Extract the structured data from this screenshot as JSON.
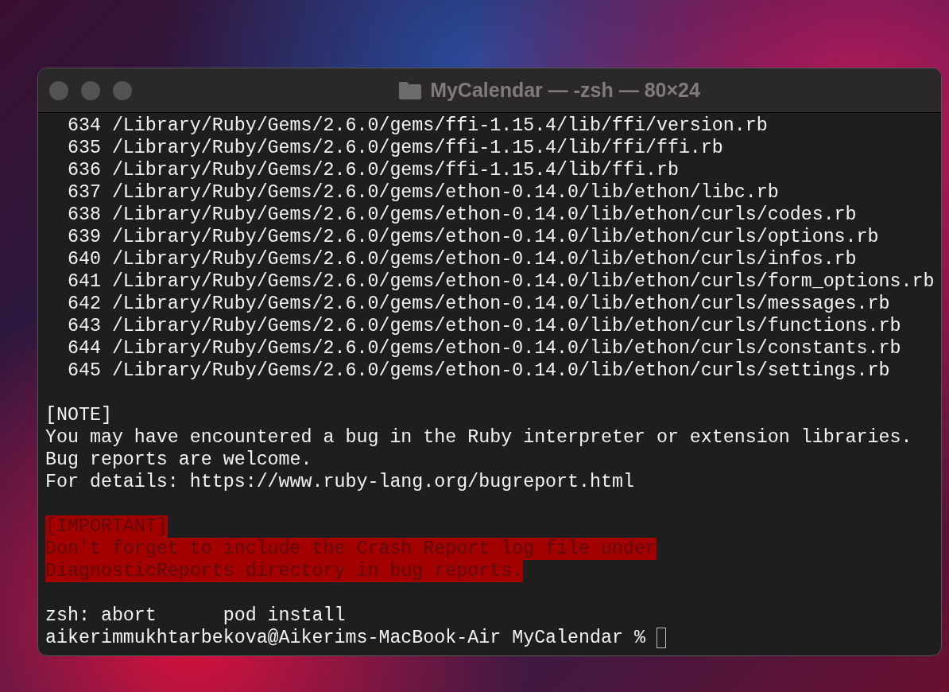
{
  "window": {
    "title": "MyCalendar — -zsh — 80×24"
  },
  "groups": [
    {
      "kind": "output",
      "lines": [
        "  634 /Library/Ruby/Gems/2.6.0/gems/ffi-1.15.4/lib/ffi/version.rb",
        "  635 /Library/Ruby/Gems/2.6.0/gems/ffi-1.15.4/lib/ffi/ffi.rb",
        "  636 /Library/Ruby/Gems/2.6.0/gems/ffi-1.15.4/lib/ffi.rb",
        "  637 /Library/Ruby/Gems/2.6.0/gems/ethon-0.14.0/lib/ethon/libc.rb",
        "  638 /Library/Ruby/Gems/2.6.0/gems/ethon-0.14.0/lib/ethon/curls/codes.rb",
        "  639 /Library/Ruby/Gems/2.6.0/gems/ethon-0.14.0/lib/ethon/curls/options.rb",
        "  640 /Library/Ruby/Gems/2.6.0/gems/ethon-0.14.0/lib/ethon/curls/infos.rb",
        "  641 /Library/Ruby/Gems/2.6.0/gems/ethon-0.14.0/lib/ethon/curls/form_options.rb",
        "  642 /Library/Ruby/Gems/2.6.0/gems/ethon-0.14.0/lib/ethon/curls/messages.rb",
        "  643 /Library/Ruby/Gems/2.6.0/gems/ethon-0.14.0/lib/ethon/curls/functions.rb",
        "  644 /Library/Ruby/Gems/2.6.0/gems/ethon-0.14.0/lib/ethon/curls/constants.rb",
        "  645 /Library/Ruby/Gems/2.6.0/gems/ethon-0.14.0/lib/ethon/curls/settings.rb"
      ]
    },
    {
      "kind": "output",
      "lines": [
        "[NOTE]",
        "You may have encountered a bug in the Ruby interpreter or extension libraries.",
        "Bug reports are welcome.",
        "For details: https://www.ruby-lang.org/bugreport.html"
      ]
    },
    {
      "kind": "alert",
      "lines": [
        "[IMPORTANT]",
        "Don't forget to include the Crash Report log file under",
        "DiagnosticReports directory in bug reports."
      ]
    },
    {
      "kind": "output",
      "lines": [
        "zsh: abort      pod install",
        "aikerimmukhtarbekova@Aikerims-MacBook-Air MyCalendar % "
      ],
      "cursor": true
    }
  ]
}
